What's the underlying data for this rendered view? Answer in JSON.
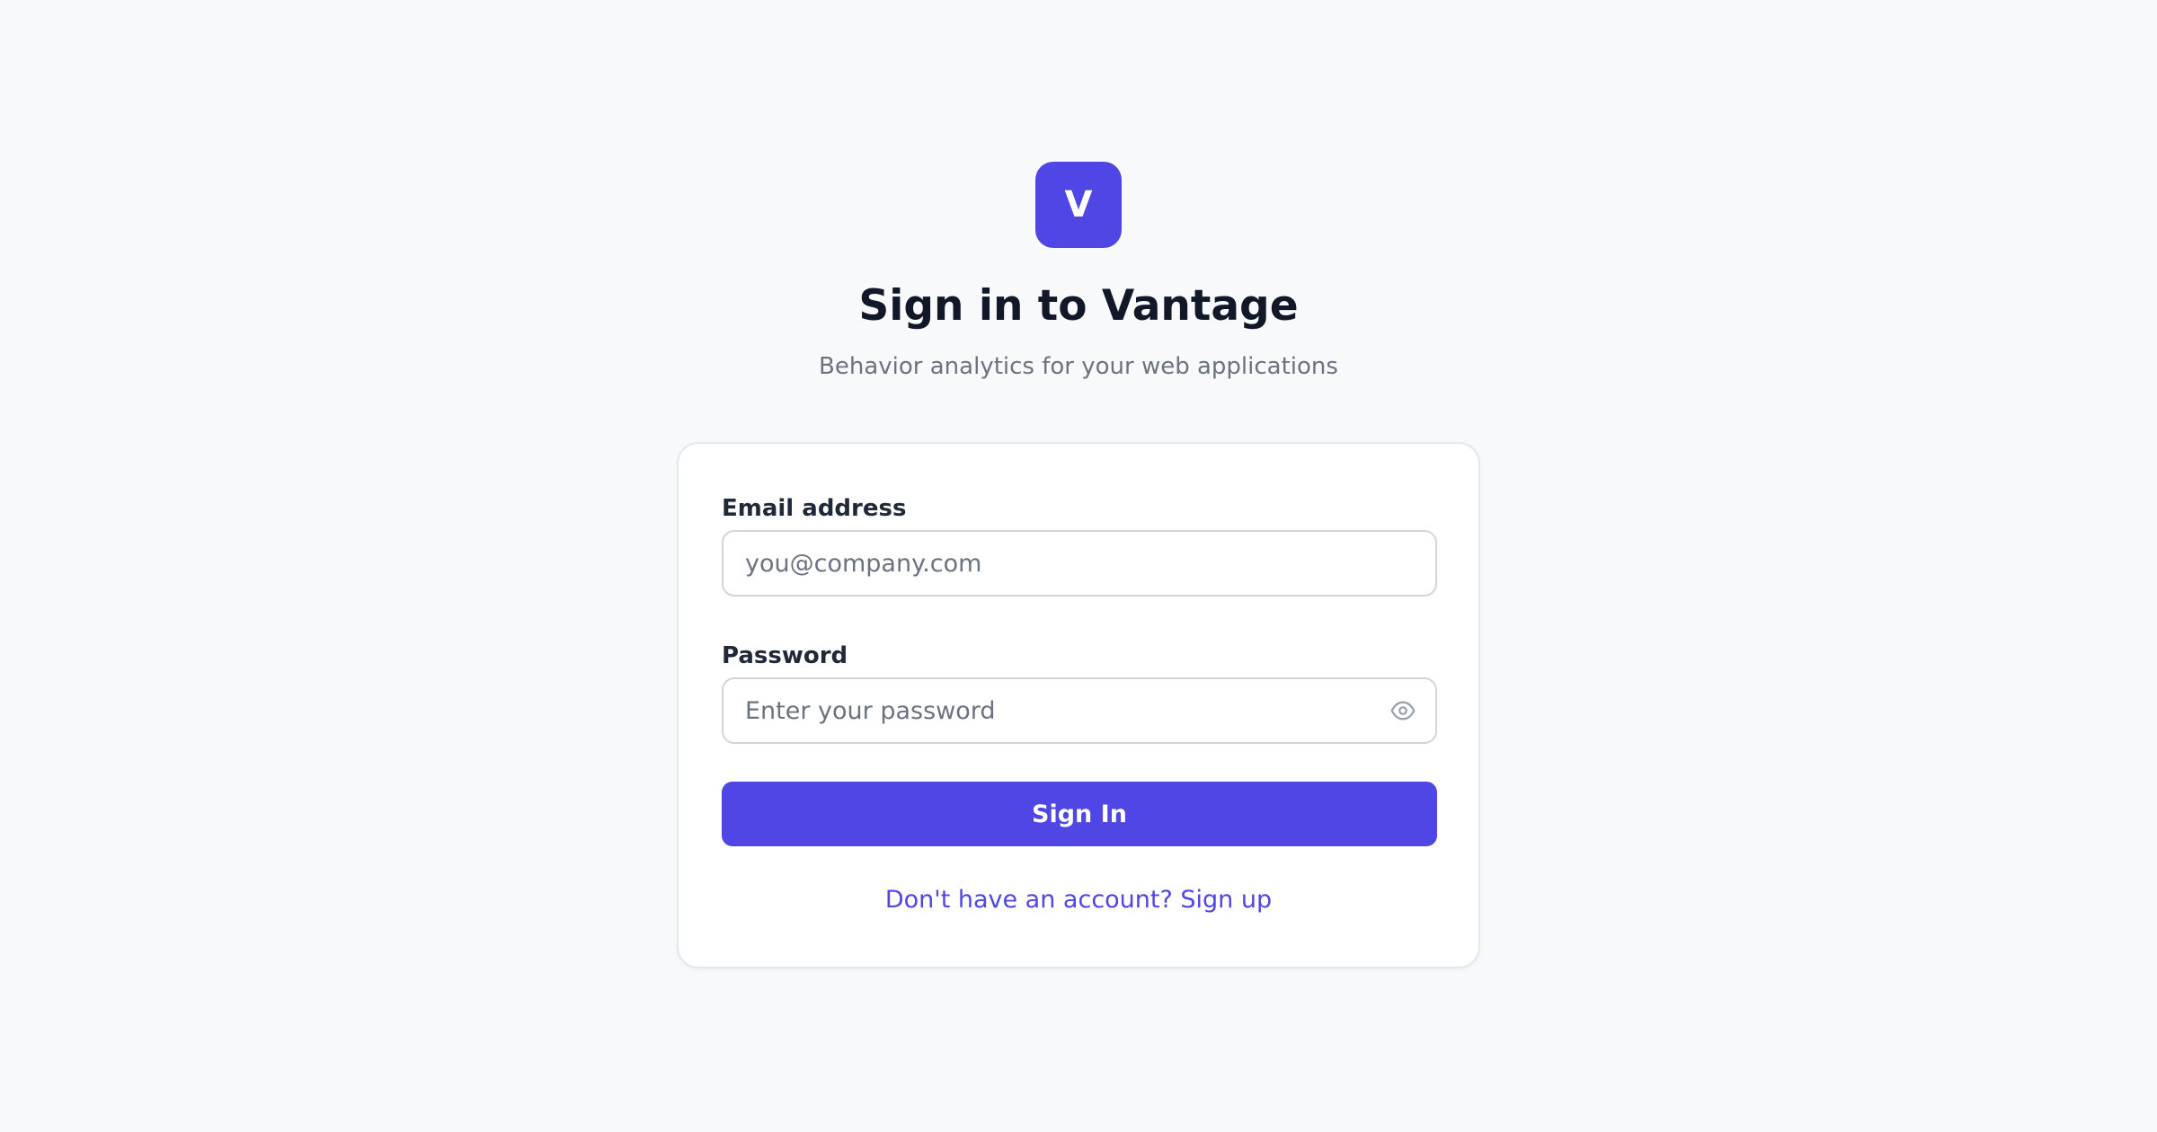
{
  "brand": {
    "logo_letter": "V",
    "accent_color": "#4f46e5"
  },
  "header": {
    "title": "Sign in to Vantage",
    "subtitle": "Behavior analytics for your web applications"
  },
  "form": {
    "email": {
      "label": "Email address",
      "value": "",
      "placeholder": "you@company.com"
    },
    "password": {
      "label": "Password",
      "value": "",
      "placeholder": "Enter your password",
      "toggle_icon": "eye-icon"
    },
    "submit_label": "Sign In",
    "signup_link": "Don't have an account? Sign up"
  }
}
